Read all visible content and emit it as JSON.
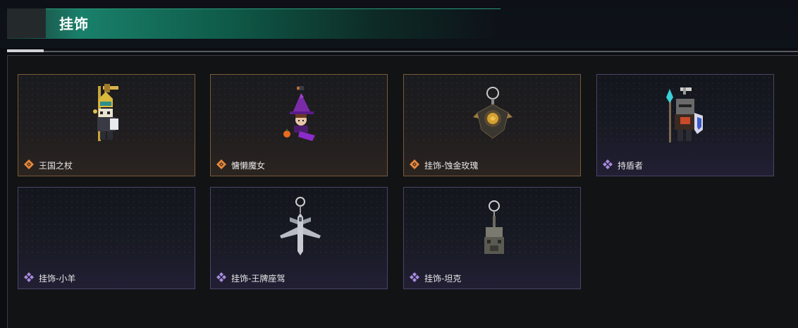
{
  "header": {
    "title": "挂饰"
  },
  "items": [
    {
      "label": "王国之杖",
      "rarity": "orange",
      "rarity_icon": "orange-diamond-icon",
      "art": "kingdom-staff-character"
    },
    {
      "label": "慵懒魔女",
      "rarity": "orange",
      "rarity_icon": "orange-diamond-icon",
      "art": "lazy-witch-character"
    },
    {
      "label": "挂饰-蚀金玫瑰",
      "rarity": "orange",
      "rarity_icon": "orange-diamond-icon",
      "art": "gold-rose-pendant"
    },
    {
      "label": "持盾者",
      "rarity": "purple",
      "rarity_icon": "purple-diamond-icon",
      "art": "shield-bearer-character"
    },
    {
      "label": "挂饰-小羊",
      "rarity": "purple",
      "rarity_icon": "purple-diamond-icon",
      "art": ""
    },
    {
      "label": "挂饰-王牌座驾",
      "rarity": "purple",
      "rarity_icon": "purple-diamond-icon",
      "art": "jet-plane-pendant"
    },
    {
      "label": "挂饰-坦克",
      "rarity": "purple",
      "rarity_icon": "purple-diamond-icon",
      "art": "tank-pendant"
    }
  ],
  "colors": {
    "accent_green": "#19806a",
    "rarity_orange": "#e8873a",
    "rarity_purple": "#a98be0"
  }
}
